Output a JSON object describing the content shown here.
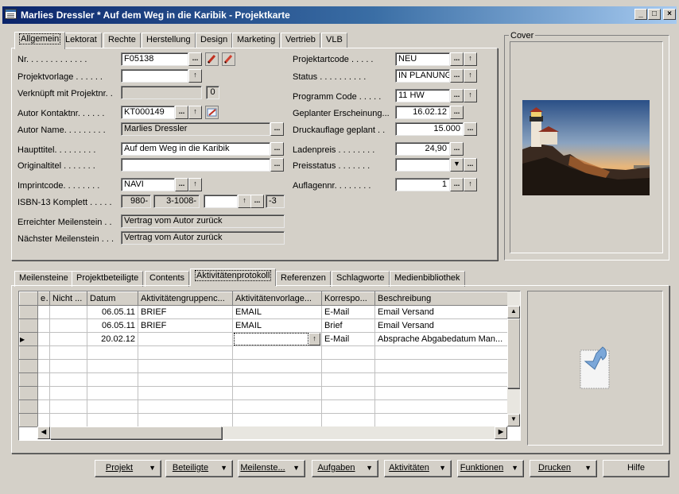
{
  "window": {
    "title": "Marlies Dressler * Auf dem Weg in die Karibik - Projektkarte",
    "minimize": "_",
    "maximize": "□",
    "close": "×"
  },
  "top_tabs": [
    "Allgemein",
    "Lektorat",
    "Rechte",
    "Herstellung",
    "Design",
    "Marketing",
    "Vertrieb",
    "VLB"
  ],
  "cover": {
    "label": "Cover"
  },
  "left_fields": {
    "nr": {
      "label": "Nr. . . . . . . . . . . . .",
      "value": "F05138"
    },
    "projektvorlage": {
      "label": "Projektvorlage . . . . . .",
      "value": ""
    },
    "verknuepft": {
      "label": "Verknüpft mit Projektnr. .",
      "value": "",
      "count": "0"
    },
    "autor_kontaktnr": {
      "label": "Autor Kontaktnr. . . . . .",
      "value": "KT000149"
    },
    "autor_name": {
      "label": "Autor Name. . . . . . . . .",
      "value": "Marlies Dressler"
    },
    "haupttitel": {
      "label": "Haupttitel. . . . . . . . .",
      "value": "Auf dem Weg in die Karibik"
    },
    "originaltitel": {
      "label": "Originaltitel . . . . . . .",
      "value": ""
    },
    "imprintcode": {
      "label": "Imprintcode. . . . . . . .",
      "value": "NAVI"
    },
    "isbn": {
      "label": "ISBN-13 Komplett . . . . .",
      "p1": "980-",
      "p2": "3-1008-",
      "p3": "",
      "p4": "-3"
    },
    "erreichter": {
      "label": "Erreichter Meilenstein . .",
      "value": "Vertrag vom Autor zurück"
    },
    "naechster": {
      "label": "Nächster Meilenstein . . .",
      "value": "Vertrag vom Autor zurück"
    }
  },
  "right_fields": {
    "projektartcode": {
      "label": "Projektartcode . . . . .",
      "value": "NEU"
    },
    "status": {
      "label": "Status . . . . . . . . . .",
      "value": "IN PLANUNG"
    },
    "programm": {
      "label": "Programm Code . . . . .",
      "value": "11 HW"
    },
    "erscheinung": {
      "label": "Geplanter Erscheinung...",
      "value": "16.02.12"
    },
    "druckauflage": {
      "label": "Druckauflage geplant . .",
      "value": "15.000"
    },
    "ladenpreis": {
      "label": "Ladenpreis . . . . . . . .",
      "value": "24,90"
    },
    "preisstatus": {
      "label": "Preisstatus . . . . . . .",
      "value": ""
    },
    "auflagennr": {
      "label": "Auflagennr. . . . . . . .",
      "value": "1"
    }
  },
  "bottom_tabs": [
    "Meilensteine",
    "Projektbeteiligte",
    "Contents",
    "Aktivitätenprotokoll",
    "Referenzen",
    "Schlagworte",
    "Medienbibliothek"
  ],
  "grid": {
    "columns": [
      "ert",
      "Nicht ...",
      "Datum",
      "Aktivitätengruppenc...",
      "Aktivitätenvorlage...",
      "Korrespo...",
      "Beschreibung"
    ],
    "rows": [
      [
        "",
        "",
        "06.05.11",
        "BRIEF",
        "EMAIL",
        "E-Mail",
        "Email Versand"
      ],
      [
        "",
        "",
        "06.05.11",
        "BRIEF",
        "EMAIL",
        "Brief",
        "Email Versand"
      ],
      [
        "",
        "",
        "20.02.12",
        "",
        "",
        "E-Mail",
        "Absprache Abgabedatum Man..."
      ]
    ]
  },
  "buttons": [
    "Projekt",
    "Beteiligte",
    "Meilenste...",
    "Aufgaben",
    "Aktivitäten",
    "Funktionen",
    "Drucken",
    "Hilfe"
  ],
  "icons": {
    "assist": "...",
    "up": "↑",
    "down": "▼",
    "arrow_right": "▶"
  }
}
